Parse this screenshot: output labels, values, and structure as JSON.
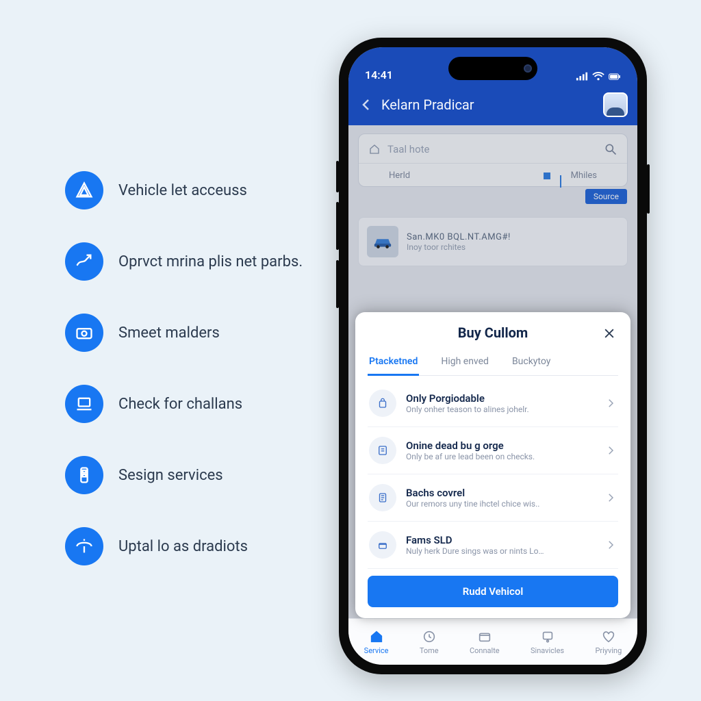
{
  "features": [
    {
      "label": "Vehicle let acceuss"
    },
    {
      "label": "Oprvct mrina plis net parbs."
    },
    {
      "label": "Smeet malders"
    },
    {
      "label": "Check for challans"
    },
    {
      "label": "Sesign services"
    },
    {
      "label": "Uptal lo as dradiots"
    }
  ],
  "status": {
    "time": "14:41"
  },
  "header": {
    "title": "Kelarn Pradicar"
  },
  "search": {
    "placeholder": "Taal hote",
    "tab1": "Herld",
    "tab2": "Mhiles",
    "badge": "Source"
  },
  "vehicle": {
    "line1": "San.MK0 BQL.NT.AMG#!",
    "line2": "Inoy toor rchites"
  },
  "sheet": {
    "title": "Buy Cullom",
    "tabs": [
      "Ptacketned",
      "High enved",
      "Buckytoy"
    ],
    "options": [
      {
        "title": "Only Porgiodable",
        "sub": "Only onher teason to alines johelr."
      },
      {
        "title": "Onine dead bu g orge",
        "sub": "Only be af ure lead been on checks."
      },
      {
        "title": "Bachs covrel",
        "sub": "Our remors uny tine ihctel chice wis.."
      },
      {
        "title": "Fams SLD",
        "sub": "Nuly herk Dure sings was or nints Lo…"
      }
    ],
    "cta": "Rudd Vehicol"
  },
  "tabs": [
    {
      "label": "Service"
    },
    {
      "label": "Tome"
    },
    {
      "label": "Connalte"
    },
    {
      "label": "Sinavicles"
    },
    {
      "label": "Priyving"
    }
  ]
}
